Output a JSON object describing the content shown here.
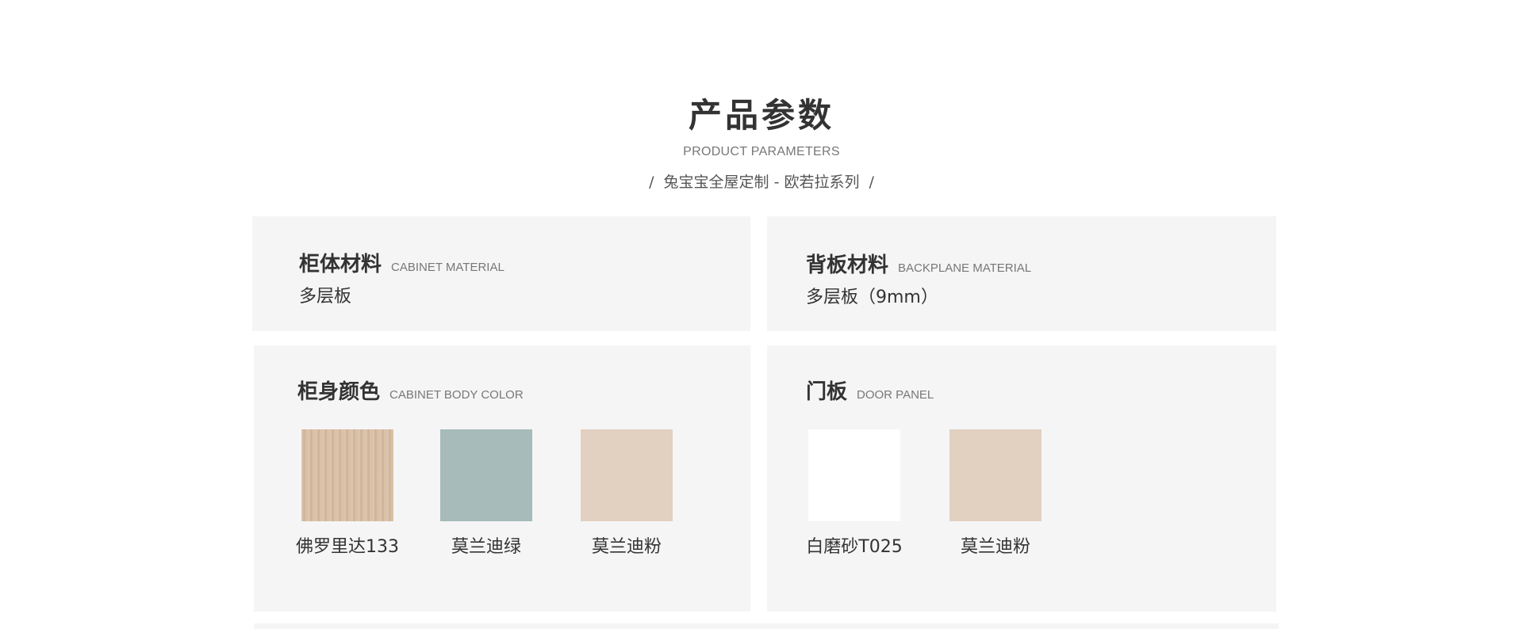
{
  "header": {
    "title": "产品参数",
    "subtitle_en": "PRODUCT PARAMETERS",
    "slash": "/",
    "series": "兔宝宝全屋定制 - 欧若拉系列"
  },
  "cabinet_material": {
    "title": "柜体材料",
    "title_en": "CABINET MATERIAL",
    "value": "多层板"
  },
  "backplane_material": {
    "title": "背板材料",
    "title_en": "BACKPLANE MATERIAL",
    "value": "多层板（9mm）"
  },
  "cabinet_body_color": {
    "title": "柜身颜色",
    "title_en": "CABINET BODY COLOR",
    "swatches": [
      {
        "label": "佛罗里达133",
        "color": "#d8bea4",
        "texture": "wood"
      },
      {
        "label": "莫兰迪绿",
        "color": "#a6bbba"
      },
      {
        "label": "莫兰迪粉",
        "color": "#e2d0c1"
      }
    ]
  },
  "door_panel": {
    "title": "门板",
    "title_en": "DOOR PANEL",
    "swatches": [
      {
        "label": "白磨砂T025",
        "color": "#ffffff"
      },
      {
        "label": "莫兰迪粉",
        "color": "#e2d0c1"
      }
    ]
  }
}
